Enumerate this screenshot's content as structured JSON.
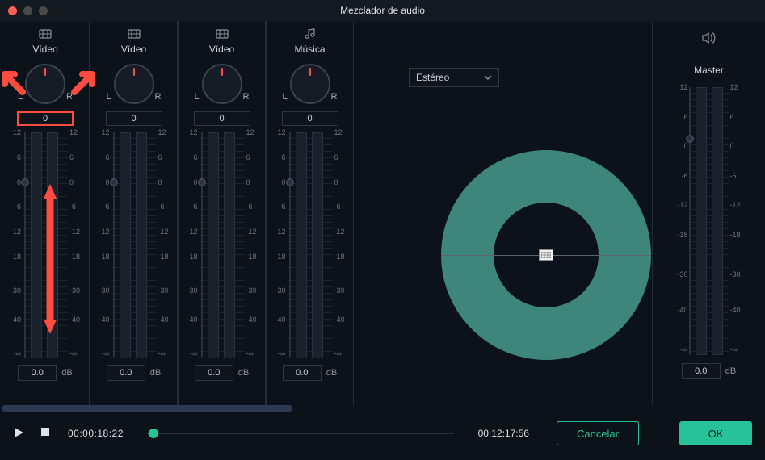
{
  "title": "Mezclador de audio",
  "channels": [
    {
      "icon": "video-icon",
      "label": "Vídeo",
      "pan_left": "L",
      "pan_right": "R",
      "pan_value": "0",
      "gain": "0.0",
      "unit": "dB",
      "highlight": true
    },
    {
      "icon": "video-icon",
      "label": "Vídeo",
      "pan_left": "L",
      "pan_right": "R",
      "pan_value": "0",
      "gain": "0.0",
      "unit": "dB",
      "highlight": false
    },
    {
      "icon": "video-icon",
      "label": "Vídeo",
      "pan_left": "L",
      "pan_right": "R",
      "pan_value": "0",
      "gain": "0.0",
      "unit": "dB",
      "highlight": false
    },
    {
      "icon": "music-icon",
      "label": "Música",
      "pan_left": "L",
      "pan_right": "R",
      "pan_value": "0",
      "gain": "0.0",
      "unit": "dB",
      "highlight": false
    }
  ],
  "scale_ticks": [
    "12",
    "6",
    "0",
    "-6",
    "-12",
    "-18",
    "-30",
    "-40",
    "-∞"
  ],
  "stereo_select": "Estéreo",
  "master": {
    "label": "Master",
    "gain": "0.0",
    "unit": "dB",
    "scale_ticks": [
      "12",
      "6",
      "0",
      "-6",
      "-12",
      "-18",
      "-30",
      "-40",
      "-∞"
    ]
  },
  "transport": {
    "current": "00:00:18:22",
    "total": "00:12:17:56"
  },
  "buttons": {
    "cancel": "Cancelar",
    "ok": "OK"
  }
}
